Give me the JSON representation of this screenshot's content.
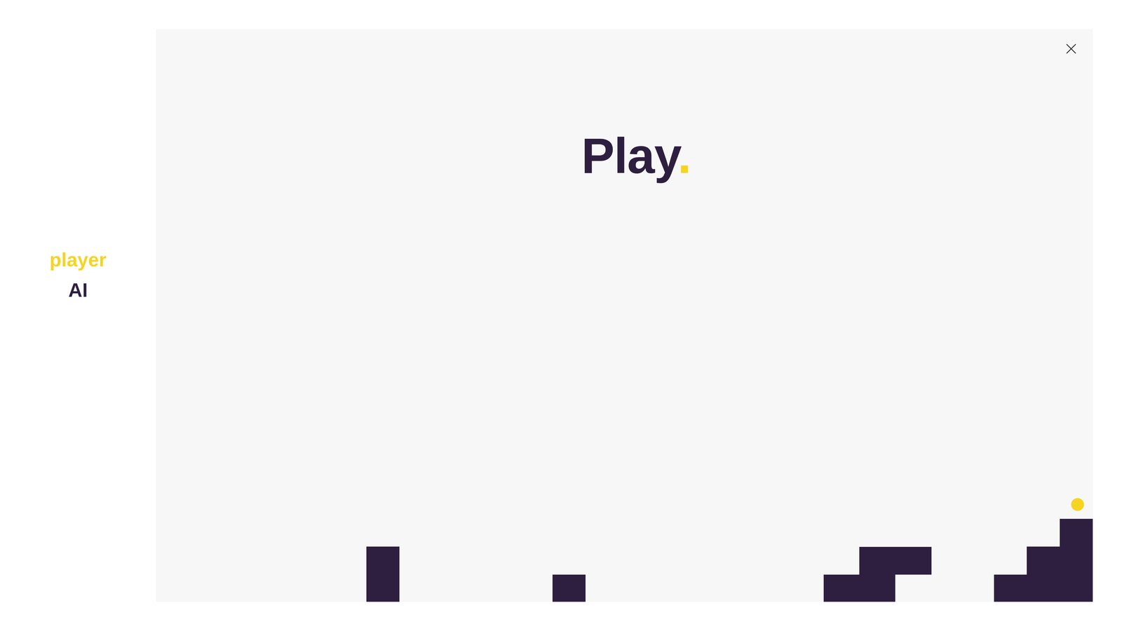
{
  "sidebar": {
    "items": [
      {
        "label": "player",
        "selected": true,
        "color": "#f5d423"
      },
      {
        "label": "AI",
        "selected": false,
        "color": "#2e1f40"
      }
    ]
  },
  "game": {
    "title": "Play",
    "title_mark": "."
  }
}
